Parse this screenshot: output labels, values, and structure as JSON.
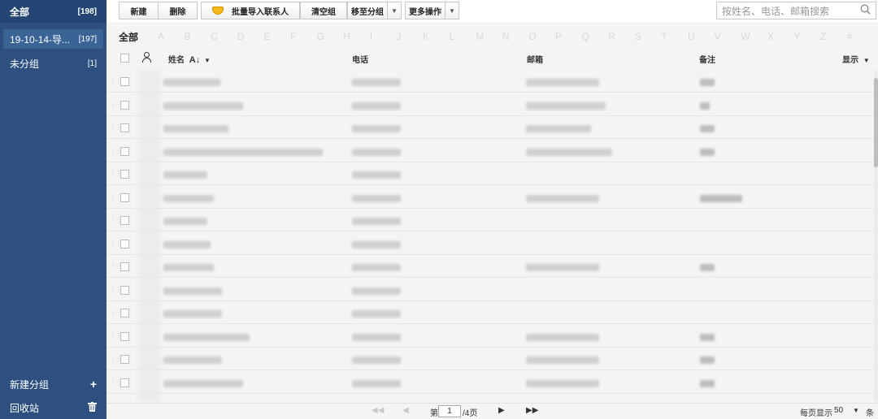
{
  "sidebar": {
    "all": {
      "label": "全部",
      "count": "[198]"
    },
    "groups": [
      {
        "label": "19-10-14-导...",
        "count": "[197]"
      },
      {
        "label": "未分组",
        "count": "[1]"
      }
    ],
    "new_group": "新建分组",
    "new_group_icon": "plus-icon",
    "trash": "回收站",
    "trash_icon": "trash-icon"
  },
  "toolbar": {
    "new": "新建",
    "delete": "删除",
    "import": "批量导入联系人",
    "clear_group": "清空组",
    "move_to_group": "移至分组",
    "more": "更多操作",
    "search_placeholder": "按姓名、电话、邮箱搜索"
  },
  "alpha": {
    "all": "全部",
    "letters": [
      "A",
      "B",
      "C",
      "D",
      "E",
      "F",
      "G",
      "H",
      "I",
      "J",
      "K",
      "L",
      "M",
      "N",
      "O",
      "P",
      "Q",
      "R",
      "S",
      "T",
      "U",
      "V",
      "W",
      "X",
      "Y",
      "Z",
      "#"
    ]
  },
  "table": {
    "columns": {
      "name": "姓名",
      "phone": "电话",
      "email": "邮箱",
      "note": "备注",
      "display": "显示"
    },
    "row_count": 14
  },
  "pagination": {
    "page_prefix": "第",
    "current_page": "1",
    "page_suffix": "/4页",
    "per_page_label": "每页显示",
    "per_page_value": "50",
    "per_page_unit": "条"
  },
  "colors": {
    "sidebar": "#2e5080",
    "sidebar_header": "#234574",
    "accent_gem": "#f2b81b"
  }
}
